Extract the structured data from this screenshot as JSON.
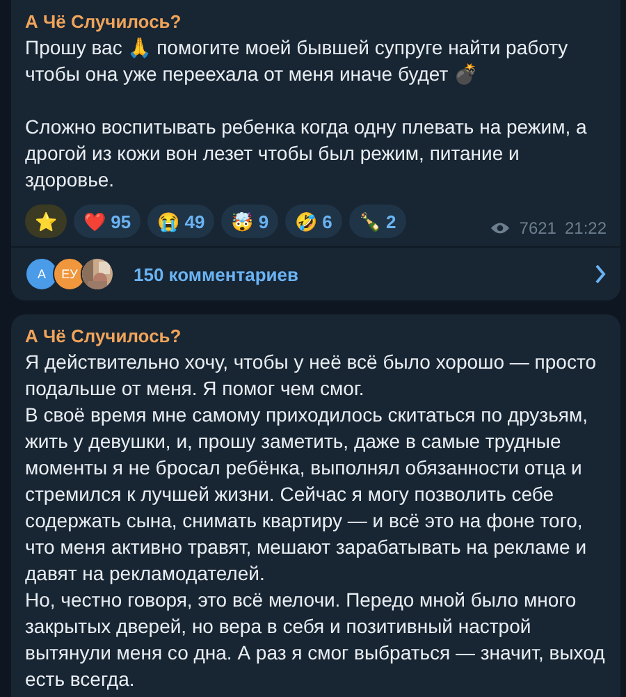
{
  "posts": [
    {
      "channel": "А Чё Случилось?",
      "spaced": true,
      "paragraphs": [
        "Прошу вас 🙏 помогите моей бывшей супруге найти работу чтобы она уже переехала от меня иначе будет 💣",
        "Сложно воспитывать ребенка когда одну плевать на режим, а дрогой из кожи вон лезет чтобы был режим, питание и здоровье."
      ],
      "reactions": [
        {
          "kind": "paid",
          "emoji": "⭐"
        },
        {
          "kind": "emoji",
          "emoji": "❤️",
          "count": "95"
        },
        {
          "kind": "emoji",
          "emoji": "😭",
          "count": "49"
        },
        {
          "kind": "emoji",
          "emoji": "🤯",
          "count": "9"
        },
        {
          "kind": "emoji",
          "emoji": "🤣",
          "count": "6"
        },
        {
          "kind": "emoji",
          "emoji": "🍾",
          "count": "2"
        }
      ],
      "views": "7621",
      "time": "21:22",
      "comments": {
        "avatars": [
          {
            "kind": "initials",
            "text": "А",
            "color": "#4a9be8"
          },
          {
            "kind": "initials",
            "text": "ЕУ",
            "color": "#f0963c"
          },
          {
            "kind": "picture"
          }
        ],
        "label": "150 комментариев"
      }
    },
    {
      "channel": "А Чё Случилось?",
      "spaced": false,
      "paragraphs": [
        "Я действительно хочу, чтобы у неё всё было хорошо — просто подальше от меня. Я помог чем смог.",
        "В своё время мне самому приходилось скитаться по друзьям, жить у девушки, и, прошу заметить, даже в самые трудные моменты я не бросал ребёнка, выполнял обязанности отца и стремился к лучшей жизни. Сейчас я могу позволить себе содержать сына, снимать квартиру — и всё это на фоне того, что меня активно травят, мешают зарабатывать на рекламе и давят на рекламодателей.",
        "Но, честно говоря, это всё мелочи. Передо мной было много закрытых дверей, но вера в себя и позитивный настрой вытянули меня со дна. А раз я смог выбраться — значит, выход есть всегда."
      ]
    }
  ]
}
